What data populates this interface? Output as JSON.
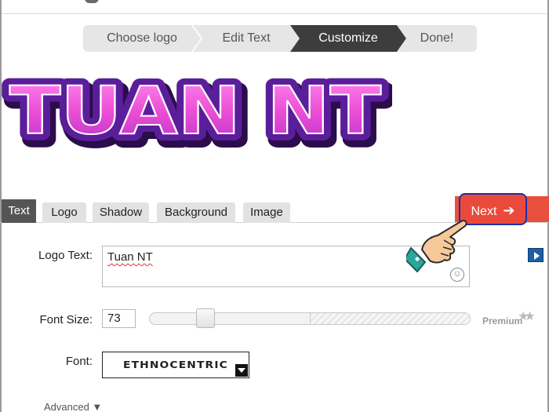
{
  "steps": [
    "Choose logo",
    "Edit Text",
    "Customize",
    "Done!"
  ],
  "active_step": "Customize",
  "logo_preview": {
    "text": "TUAN NT"
  },
  "tabs": [
    "Text",
    "Logo",
    "Shadow",
    "Background",
    "Image"
  ],
  "active_tab": "Text",
  "next_button": {
    "label": "Next"
  },
  "form": {
    "logo_text_label": "Logo Text:",
    "logo_text_value": "Tuan NT",
    "font_size_label": "Font Size:",
    "font_size_value": "73",
    "font_size_slider": 73,
    "premium_label": "Premium",
    "font_label": "Font:",
    "font_value": "ETHNOCENTRIC",
    "advanced_label": "Advanced ▼"
  },
  "colors": {
    "accent_red": "#ea4a3c",
    "logo_purple": "#5b1e9a",
    "logo_pink": "#ec4fd6",
    "active_step": "#3d3d3d"
  },
  "icons": [
    "emoji-icon",
    "media-icon",
    "arrow-right-icon",
    "pointing-hand-icon",
    "chevron-down-icon",
    "star-icon"
  ]
}
